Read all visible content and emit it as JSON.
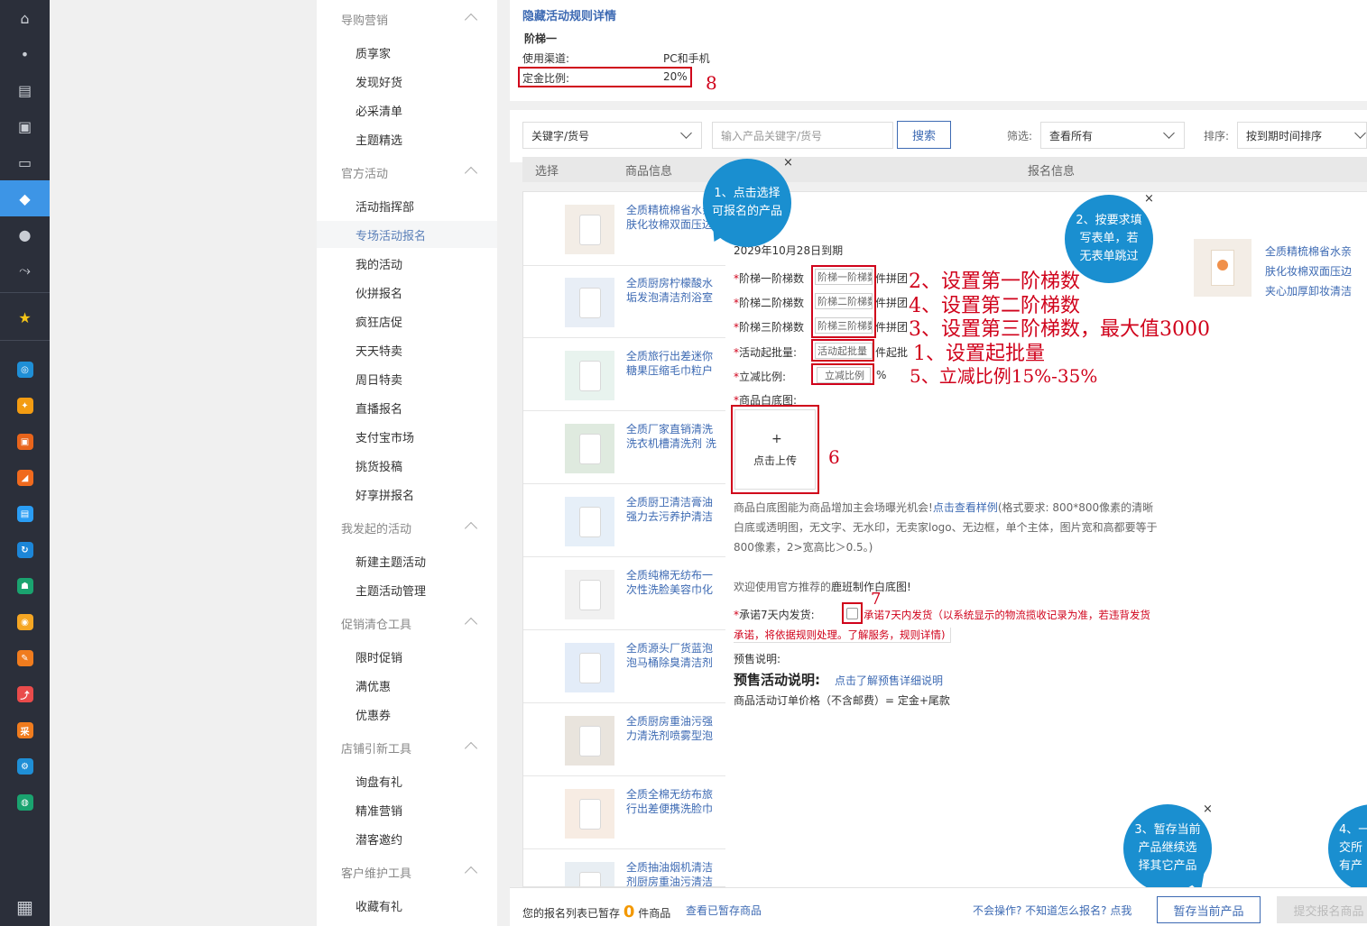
{
  "rail": {
    "icons": [
      "home-icon",
      "dot-icon",
      "clipboard-icon",
      "inbox-icon",
      "store-icon",
      "tag-icon",
      "user-icon",
      "share-icon",
      "star-icon"
    ],
    "apps": [
      {
        "name": "app-icon-1",
        "color": "#1f8fd6",
        "glyph": "◎"
      },
      {
        "name": "app-icon-2",
        "color": "#f39c12",
        "glyph": "✦"
      },
      {
        "name": "app-icon-3",
        "color": "#e8641b",
        "glyph": "▣"
      },
      {
        "name": "app-icon-4",
        "color": "#f06a1e",
        "glyph": "◢"
      },
      {
        "name": "app-icon-5",
        "color": "#2a9df4",
        "glyph": "▤"
      },
      {
        "name": "app-icon-6",
        "color": "#1c86d8",
        "glyph": "↻"
      },
      {
        "name": "app-icon-7",
        "color": "#1aa36f",
        "glyph": "☗"
      },
      {
        "name": "app-icon-8",
        "color": "#f5a623",
        "glyph": "◉"
      },
      {
        "name": "app-icon-9",
        "color": "#f07c1e",
        "glyph": "✎"
      },
      {
        "name": "app-icon-10",
        "color": "#e94b4b",
        "glyph": "⤴"
      },
      {
        "name": "app-icon-11",
        "color": "#f07c1e",
        "glyph": "采"
      },
      {
        "name": "app-icon-12",
        "color": "#1f8fd6",
        "glyph": "⚙"
      },
      {
        "name": "app-icon-13",
        "color": "#1aa36f",
        "glyph": "◍"
      }
    ]
  },
  "sidebar": {
    "groups": [
      {
        "title": "导购营销",
        "items": [
          "质享家",
          "发现好货",
          "必采清单",
          "主题精选"
        ]
      },
      {
        "title": "官方活动",
        "items": [
          "活动指挥部",
          "专场活动报名",
          "我的活动",
          "伙拼报名",
          "疯狂店促",
          "天天特卖",
          "周日特卖",
          "直播报名",
          "支付宝市场",
          "挑货投稿",
          "好享拼报名"
        ]
      },
      {
        "title": "我发起的活动",
        "items": [
          "新建主题活动",
          "主题活动管理"
        ]
      },
      {
        "title": "促销清仓工具",
        "items": [
          "限时促销",
          "满优惠",
          "优惠券"
        ]
      },
      {
        "title": "店铺引新工具",
        "items": [
          "询盘有礼",
          "精准营销",
          "潜客邀约"
        ]
      },
      {
        "title": "客户维护工具",
        "items": [
          "收藏有礼"
        ]
      }
    ],
    "active_item": "专场活动报名"
  },
  "rules": {
    "title": "隐藏活动规则详情",
    "tier": "阶梯一",
    "channel_label": "使用渠道:",
    "channel_value": "PC和手机",
    "deposit_label": "定金比例:",
    "deposit_value": "20%",
    "anno": "8"
  },
  "filter": {
    "keyword_type": "关键字/货号",
    "search_placeholder": "输入产品关键字/货号",
    "search_button": "搜索",
    "filter_label": "筛选:",
    "filter_value": "查看所有",
    "sort_label": "排序:",
    "sort_value": "按到期时间排序"
  },
  "table": {
    "col_select": "选择",
    "col_product": "商品信息",
    "col_signup": "报名信息"
  },
  "products": [
    {
      "title": "全质精梳棉省水亲肤化妆棉双面压边",
      "img": "#f3ede6"
    },
    {
      "title": "全质厨房柠檬酸水垢发泡清洁剂浴室",
      "img": "#e8eef6"
    },
    {
      "title": "全质旅行出差迷你糖果压缩毛巾粒户",
      "img": "#e8f3ee"
    },
    {
      "title": "全质厂家直销清洗洗衣机槽清洗剂 洗",
      "img": "#dfeadf"
    },
    {
      "title": "全质厨卫清洁膏油强力去污养护清洁",
      "img": "#e6eff8"
    },
    {
      "title": "全质纯棉无纺布一次性洗脸美容巾化",
      "img": "#f1f1f1"
    },
    {
      "title": "全质源头厂货蓝泡泡马桶除臭清洁剂",
      "img": "#e3ecf8"
    },
    {
      "title": "全质厨房重油污强力清洗剂喷雾型泡",
      "img": "#e9e4dd"
    },
    {
      "title": "全质全棉无纺布旅行出差便携洗脸巾",
      "img": "#f7ece3"
    },
    {
      "title": "全质抽油烟机清洁剂厨房重油污清洁",
      "img": "#e8eef3"
    }
  ],
  "form": {
    "expire": "2029年10月28日到期",
    "tier1_label": "阶梯一阶梯数",
    "tier1_placeholder": "阶梯一阶梯数",
    "tier2_label": "阶梯二阶梯数",
    "tier2_placeholder": "阶梯二阶梯数",
    "tier3_label": "阶梯三阶梯数",
    "tier3_placeholder": "阶梯三阶梯数",
    "unit_group": "件拼团",
    "min_batch_label": "活动起批量:",
    "min_batch_placeholder": "活动起批量",
    "unit_min": "件起批",
    "discount_label": "立减比例:",
    "discount_placeholder": "立减比例",
    "percent": "%",
    "white_img_label": "商品白底图:",
    "upload_plus": "+",
    "upload_label": "点击上传",
    "desc_line1_a": "商品白底图能为商品增加主会场曝光机会!",
    "desc_line1_link": "点击查看样例",
    "desc_line1_b": "(格式要求: 800*800像素的清晰",
    "desc_line2": "白底或透明图，无文字、无水印，无卖家logo、无边框，单个主体，图片宽和高都要等于",
    "desc_line3": "800像素，2>宽高比＞0.5。)",
    "welcome_a": "欢迎使用官方推荐的",
    "welcome_link": "鹿班制作白底图!",
    "promise_label": "承诺7天内发货:",
    "promise_text1": "承诺7天内发货（以系统显示的物流揽收记录为准，若违背发货",
    "promise_text2": "承诺，将依据规则处理。了解服务，规则详情)",
    "presale_label": "预售说明:",
    "presale_title": "预售活动说明:",
    "presale_link": "点击了解预售详细说明",
    "price_formula": "商品活动订单价格（不含邮费）= 定金+尾款"
  },
  "annotations": {
    "a2": "2、设置第一阶梯数",
    "a4": "4、设置第二阶梯数",
    "a3": "3、设置第三阶梯数，最大值3000",
    "a1": "1、设置起批量",
    "a5": "5、立减比例15%-35%",
    "a6": "6",
    "a7": "7"
  },
  "bubbles": {
    "b1": "1、点击选择可报名的产品",
    "b2": "2、按要求填写表单，若无表单跳过",
    "b3": "3、暂存当前产品继续选择其它产品",
    "b4": "4、一交所有产",
    "close": "×"
  },
  "selected_product": {
    "title1": "全质精梳棉省水亲",
    "title2": "肤化妆棉双面压边",
    "title3": "夹心加厚卸妆清洁"
  },
  "bottom": {
    "saved_prefix": "您的报名列表已暂存",
    "saved_count": "0",
    "saved_suffix": "件商品",
    "view_saved": "查看已暂存商品",
    "help": "不会操作? 不知道怎么报名? 点我",
    "save_button": "暂存当前产品",
    "submit_button": "提交报名商品"
  }
}
